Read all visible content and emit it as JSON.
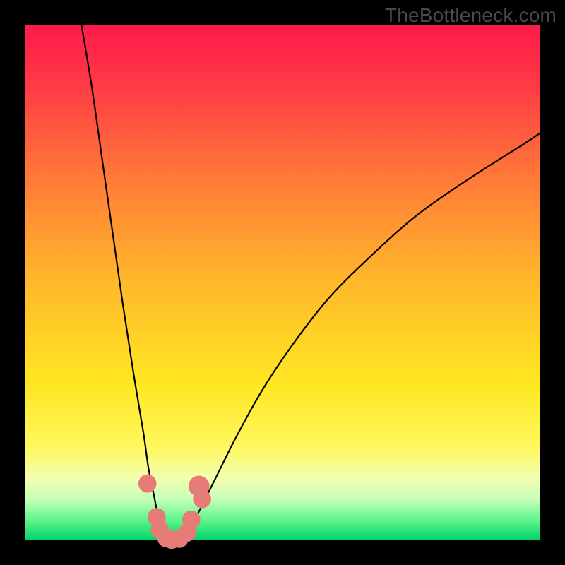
{
  "watermark": "TheBottleneck.com",
  "chart_data": {
    "type": "line",
    "title": "",
    "xlabel": "",
    "ylabel": "",
    "xlim": [
      0,
      100
    ],
    "ylim": [
      0,
      100
    ],
    "gradient": [
      {
        "stop": 0.0,
        "color": "#ff1a4b"
      },
      {
        "stop": 0.12,
        "color": "#ff3b45"
      },
      {
        "stop": 0.3,
        "color": "#ff7a38"
      },
      {
        "stop": 0.5,
        "color": "#ffb92a"
      },
      {
        "stop": 0.7,
        "color": "#ffe722"
      },
      {
        "stop": 0.82,
        "color": "#fff85f"
      },
      {
        "stop": 0.88,
        "color": "#f2ffb0"
      },
      {
        "stop": 0.92,
        "color": "#c7ffba"
      },
      {
        "stop": 0.96,
        "color": "#60f58b"
      },
      {
        "stop": 1.0,
        "color": "#00d36a"
      }
    ],
    "series": [
      {
        "name": "left-branch",
        "x": [
          11,
          13,
          15,
          17,
          19,
          21,
          23,
          24,
          25,
          25.8,
          26.4,
          27
        ],
        "y": [
          100,
          88,
          74,
          60,
          46,
          33,
          21,
          14,
          9,
          5,
          2.5,
          0.5
        ]
      },
      {
        "name": "right-branch",
        "x": [
          31,
          32.2,
          34,
          37,
          41,
          46,
          52,
          59,
          67,
          76,
          86,
          97,
          100
        ],
        "y": [
          0.5,
          2.5,
          6,
          12,
          20,
          29,
          38,
          47,
          55,
          63,
          70,
          77,
          79
        ]
      },
      {
        "name": "valley-floor",
        "x": [
          27,
          28,
          29,
          30,
          31
        ],
        "y": [
          0.5,
          0.1,
          0.0,
          0.1,
          0.5
        ]
      }
    ],
    "markers": [
      {
        "x": 23.8,
        "y": 11.0,
        "r": 1.2
      },
      {
        "x": 25.6,
        "y": 4.5,
        "r": 1.2
      },
      {
        "x": 26.2,
        "y": 2.0,
        "r": 1.2
      },
      {
        "x": 27.5,
        "y": 0.4,
        "r": 1.2
      },
      {
        "x": 28.5,
        "y": 0.1,
        "r": 1.2
      },
      {
        "x": 30.0,
        "y": 0.3,
        "r": 1.2
      },
      {
        "x": 31.5,
        "y": 1.5,
        "r": 1.2
      },
      {
        "x": 32.3,
        "y": 4.0,
        "r": 1.2
      },
      {
        "x": 33.8,
        "y": 10.5,
        "r": 1.5
      },
      {
        "x": 34.4,
        "y": 8.0,
        "r": 1.2
      }
    ]
  }
}
